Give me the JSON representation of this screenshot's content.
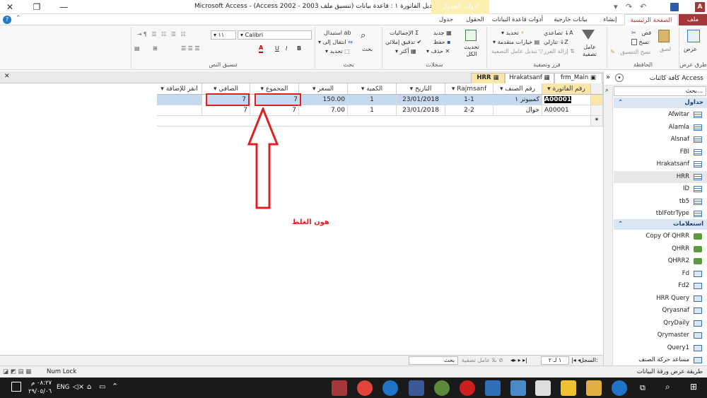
{
  "title": {
    "app_title": "Microsoft Access - (Access 2002 - 2003 تعديل الفاتورة ١ : قاعدة بيانات (تنسيق ملف",
    "context_header": "أدوات الجدول",
    "minimize": "—",
    "restore": "❐",
    "close": "✕"
  },
  "tabs": {
    "file": "ملف",
    "home": "الصفحة الرئيسية",
    "create": "إنشاء",
    "external": "بيانات خارجية",
    "dbtools": "أدوات قاعدة البيانات",
    "fields": "الحقول",
    "table": "جدول"
  },
  "ribbon": {
    "views": {
      "view": "عرض",
      "label": "طرق عرض"
    },
    "clipboard": {
      "paste": "لصق",
      "cut": "قص",
      "copy": "نسخ",
      "format_painter": "نسخ التنسيق",
      "label": "الحافظة"
    },
    "sort_filter": {
      "filter": "عامل تصفية",
      "ascending": "تصاعدي",
      "descending": "تنازلي",
      "remove_sort": "إزالة الفرز",
      "selection": "تحديد",
      "advanced": "خيارات متقدمة",
      "toggle_filter": "تبديل عامل التصفية",
      "label": "فرز وتصفية"
    },
    "records": {
      "refresh": "تحديث الكل",
      "new": "جديد",
      "save": "حفظ",
      "delete": "حذف",
      "totals": "الإجماليات",
      "spelling": "تدقيق إملائي",
      "more": "أكثر",
      "label": "سجلات"
    },
    "find": {
      "find": "بحث",
      "replace": "استبدال",
      "goto": "انتقال إلى",
      "select": "تحديد",
      "label": "بحث"
    },
    "text_format": {
      "font": "Calibri",
      "size": "١١",
      "label": "تنسيق النص",
      "bold": "B",
      "italic": "I",
      "underline": "U",
      "font_color": "A"
    }
  },
  "nav": {
    "title": "كافة كائنات Access",
    "search_placeholder": "بحث...",
    "tables_header": "جداول",
    "tables": [
      "AfwItar",
      "Alamla",
      "Alsnaf",
      "FBI",
      "Hrakatsanf",
      "HRR",
      "ID",
      "tb5",
      "tblFotrType"
    ],
    "queries_header": "استعلامات",
    "queries": [
      {
        "name": "Copy Of QHRR",
        "icon": "query-icon"
      },
      {
        "name": "QHRR",
        "icon": "query-icon"
      },
      {
        "name": "QHRR2",
        "icon": "query-icon"
      },
      {
        "name": "Fd",
        "icon": "form-icon"
      },
      {
        "name": "Fd2",
        "icon": "form-icon"
      },
      {
        "name": "HRR Query",
        "icon": "form-icon"
      },
      {
        "name": "Qryasnaf",
        "icon": "form-icon"
      },
      {
        "name": "QryDaily",
        "icon": "form-icon"
      },
      {
        "name": "Qrymaster",
        "icon": "form-icon"
      },
      {
        "name": "Query1",
        "icon": "form-icon"
      },
      {
        "name": "مساعد حركة الصنف",
        "icon": "form-icon"
      }
    ]
  },
  "doc_tabs": [
    "frm_Main",
    "Hrakatsanf",
    "HRR"
  ],
  "table": {
    "columns": [
      "رقم الفاتورة",
      "رقم الصنف",
      "Rajmsanf",
      "التاريخ",
      "الكمية",
      "السعر",
      "المجموع",
      "الصافي",
      "انقر للإضافة"
    ],
    "rows": [
      [
        "A00001",
        "كمبيوتر ١",
        "1-1",
        "23/01/2018",
        "1",
        "150.00",
        "7",
        "7",
        ""
      ],
      [
        "A00001",
        "جوال",
        "2-2",
        "23/01/2018",
        "1",
        "7.00",
        "7",
        "7",
        ""
      ]
    ],
    "new_row_marker": "*"
  },
  "annotation": {
    "text": "هون الغلط",
    "color": "#e02020"
  },
  "record_nav": {
    "label": "السجل:",
    "position": "١ لـ ٢",
    "no_filter": "بلا عامل تصفية",
    "search": "بحث"
  },
  "status": {
    "view_name": "طريقة عرض ورقة البيانات",
    "numlock": "Num Lock"
  },
  "taskbar": {
    "time": "٠٨:٢٧ م",
    "date": "٢٩/٠٥/٠٦",
    "lang": "ENG"
  },
  "colors": {
    "access_red": "#a4373a",
    "selection": "#c5d9f0",
    "annotation": "#e02020"
  }
}
